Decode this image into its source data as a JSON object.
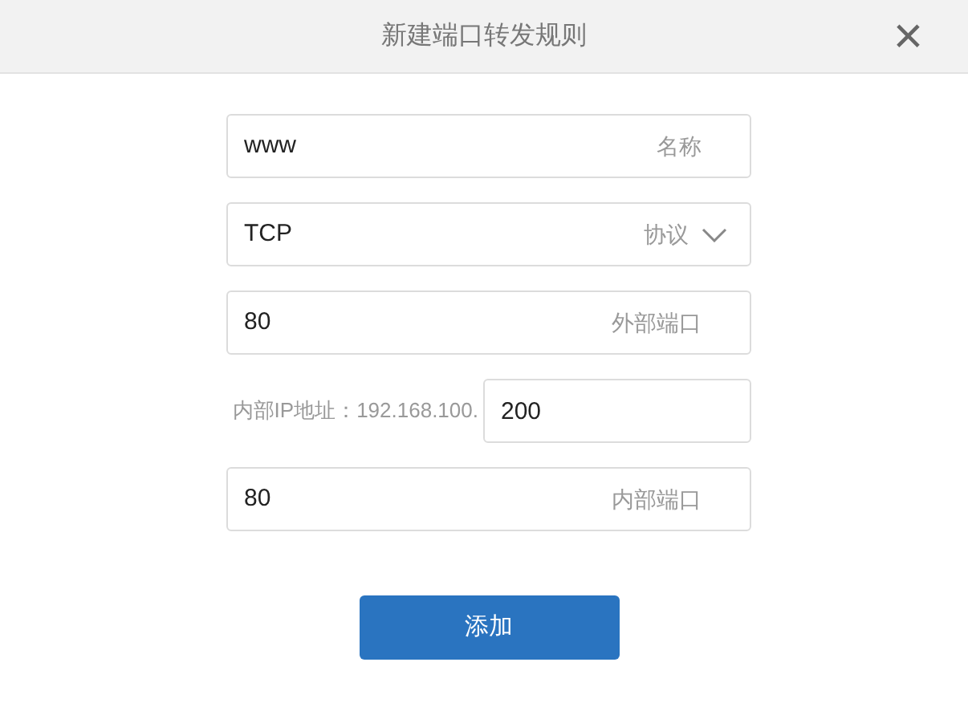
{
  "dialog": {
    "title": "新建端口转发规则",
    "close": "×"
  },
  "fields": [
    {
      "kind": "text",
      "value": "www",
      "label": "名称"
    },
    {
      "kind": "select",
      "value": "TCP",
      "label": "协议"
    },
    {
      "kind": "text",
      "value": "80",
      "label": "外部端口"
    },
    {
      "kind": "prefixed",
      "prefix": "内部IP地址：192.168.100.",
      "value": "200"
    },
    {
      "kind": "text",
      "value": "80",
      "label": "内部端口"
    }
  ],
  "submit": "添加"
}
